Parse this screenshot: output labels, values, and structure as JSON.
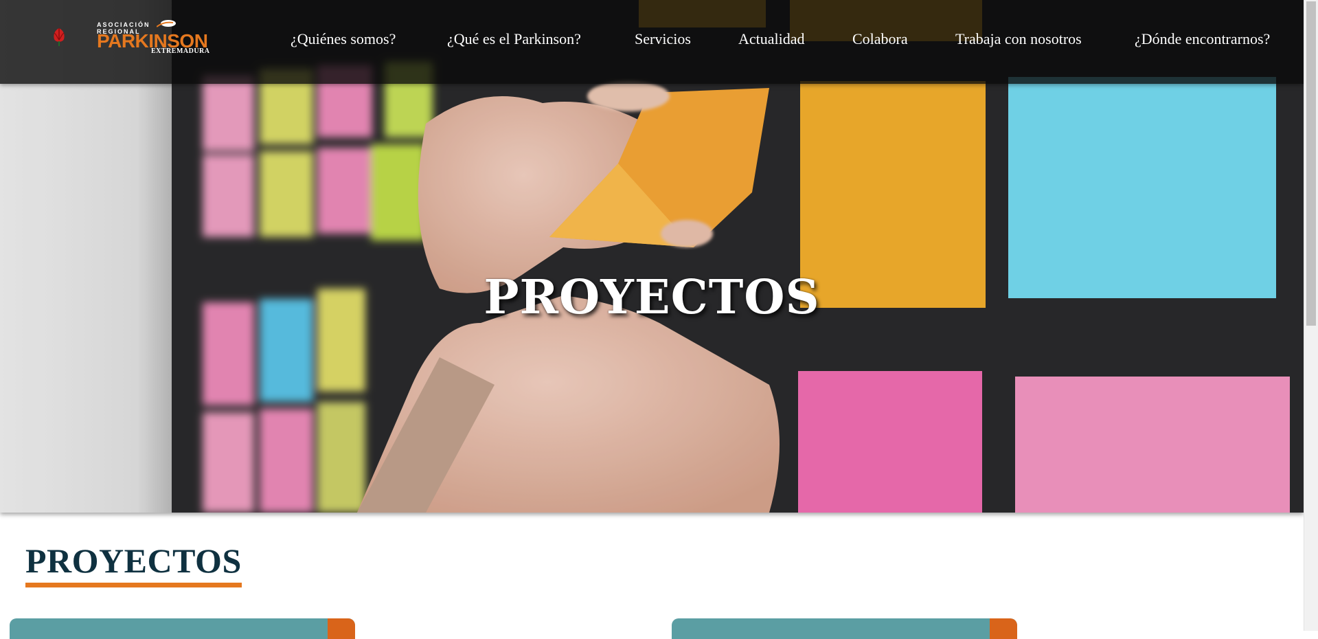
{
  "header": {
    "logo": {
      "line1": "ASOCIACIÓN",
      "line2": "REGIONAL",
      "main": "PARKINSON",
      "sub": "EXTREMADURA",
      "icon": "tulip-icon"
    },
    "nav": [
      {
        "label": "¿Quiénes somos?"
      },
      {
        "label": "¿Qué es el Parkinson?"
      },
      {
        "label": "Servicios"
      },
      {
        "label": "Actualidad"
      },
      {
        "label": "Colabora"
      },
      {
        "label": "Trabaja con nosotros"
      },
      {
        "label": "¿Dónde encontrarnos?"
      }
    ]
  },
  "hero": {
    "title": "PROYECTOS",
    "image": "hands-placing-sticky-notes-on-board"
  },
  "section": {
    "title": "PROYECTOS"
  },
  "colors": {
    "brand_orange": "#e5781f",
    "heading_dark": "#0f3140",
    "card_teal": "#5b9ea3",
    "card_accent": "#d9641a",
    "header_bg": "rgba(10,10,10,0.80)"
  }
}
